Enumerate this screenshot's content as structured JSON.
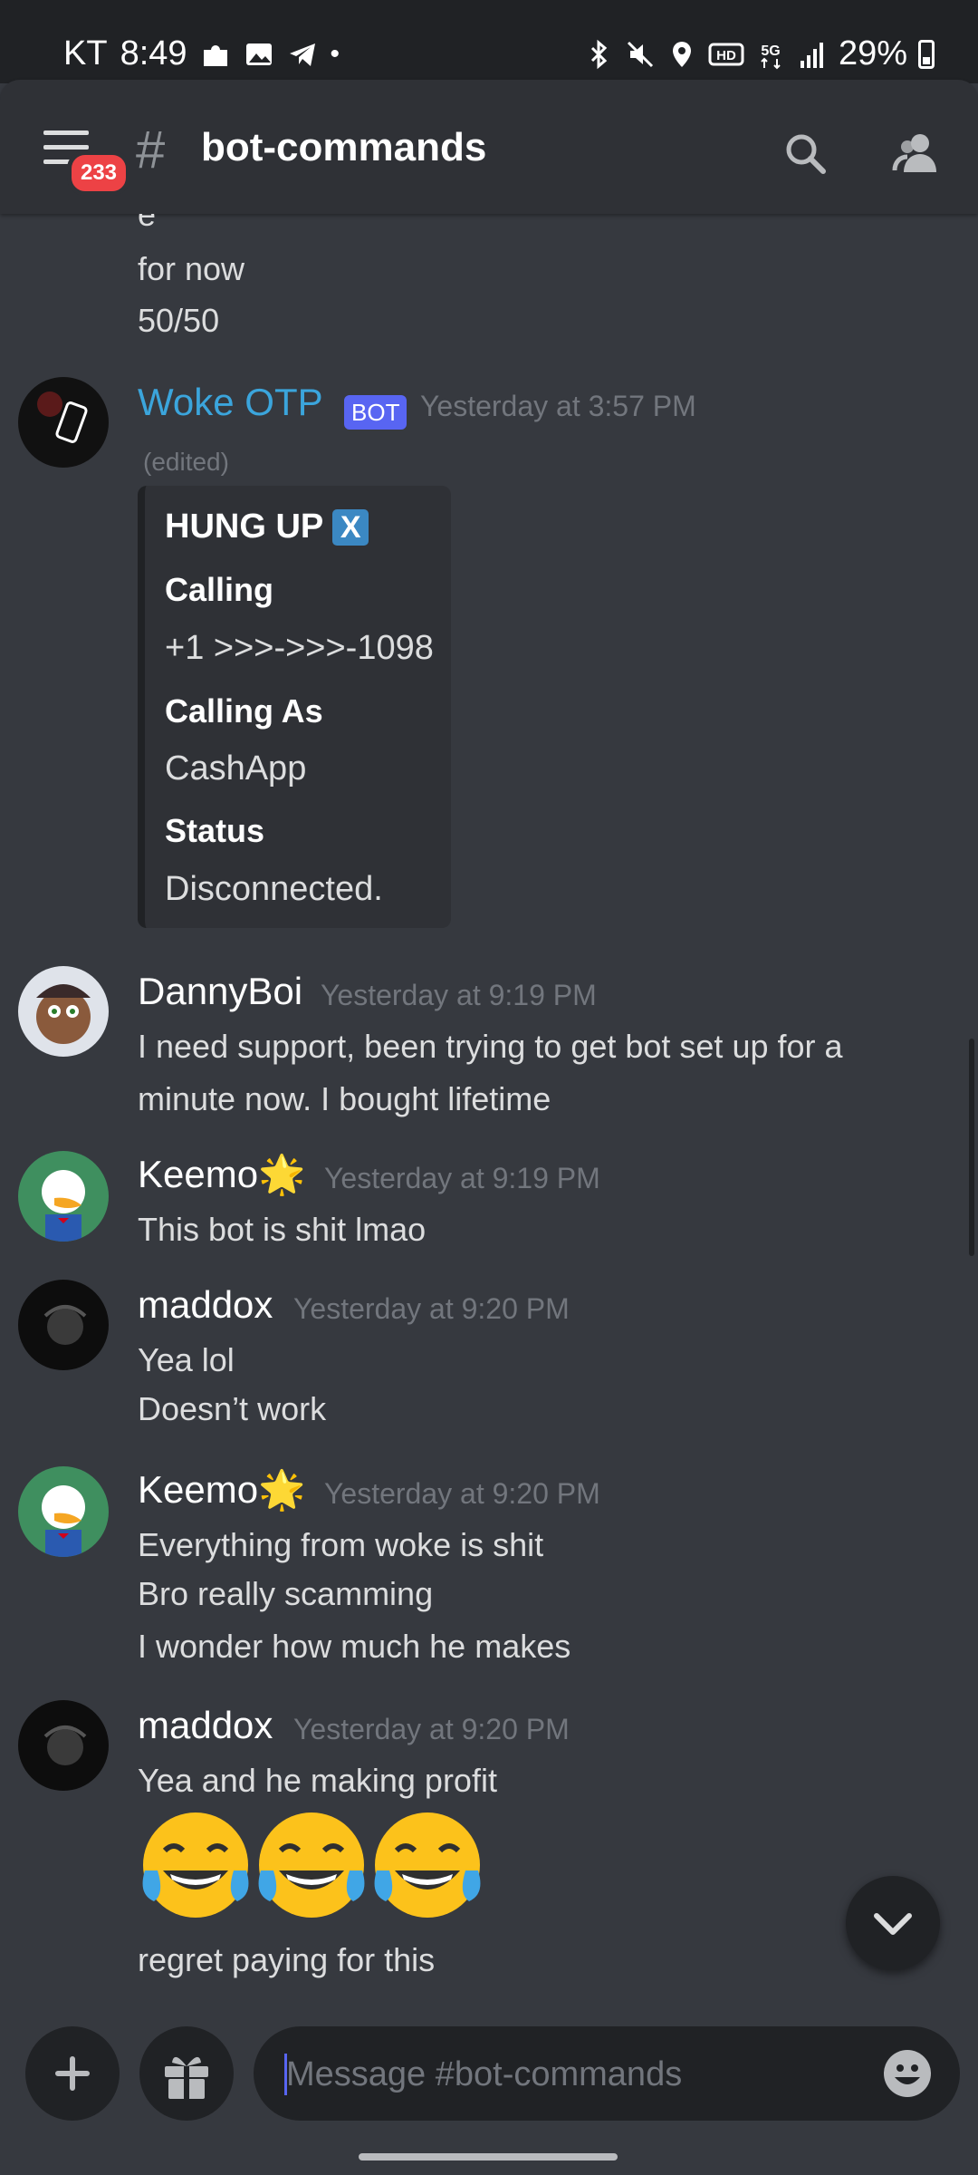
{
  "status_bar": {
    "carrier": "KT",
    "time": "8:49",
    "dot": "•",
    "battery": "29%",
    "icons_left": [
      "puzzle-icon",
      "gallery-icon",
      "telegram-icon"
    ],
    "icons_right": [
      "bluetooth-icon",
      "mute-icon",
      "location-icon",
      "hd-icon",
      "5g-icon",
      "signal-icon",
      "battery-icon"
    ]
  },
  "header": {
    "badge": "233",
    "hash": "#",
    "channel": "bot-commands"
  },
  "messages": {
    "orphan_lines": [
      "e",
      "for now",
      "50/50"
    ],
    "woke": {
      "author": "Woke OTP",
      "bot_tag": "BOT",
      "time": "Yesterday at 3:57 PM",
      "edited": "(edited)",
      "embed": {
        "title": "HUNG UP",
        "x_glyph": "X",
        "fields": [
          {
            "name": "Calling",
            "value": "+1 >>>->>>-1098"
          },
          {
            "name": "Calling As",
            "value": "CashApp"
          },
          {
            "name": "Status",
            "value": "Disconnected."
          }
        ]
      }
    },
    "danny": {
      "author": "DannyBoi",
      "time": "Yesterday at 9:19 PM",
      "lines": [
        "I need support, been trying to get bot set up for a",
        "minute now. I bought lifetime"
      ]
    },
    "keemo1": {
      "author": "Keemo🌟",
      "time": "Yesterday at 9:19 PM",
      "lines": [
        "This bot is shit lmao"
      ]
    },
    "maddox1": {
      "author": "maddox",
      "time": "Yesterday at 9:20 PM",
      "lines": [
        "Yea lol",
        "Doesn’t work"
      ]
    },
    "keemo2": {
      "author": "Keemo🌟",
      "time": "Yesterday at 9:20 PM",
      "lines": [
        "Everything from woke is shit",
        "Bro really scamming",
        "I wonder how much he makes"
      ]
    },
    "maddox2": {
      "author": "maddox",
      "time": "Yesterday at 9:20 PM",
      "lines": [
        "Yea and he making profit",
        "regret paying for this"
      ],
      "emoji": [
        "😂",
        "😂",
        "😂"
      ]
    }
  },
  "composer": {
    "placeholder": "Message #bot-commands"
  },
  "colors": {
    "background": "#36393f",
    "header": "#2f3136",
    "bot_name": "#3ba5dc",
    "bot_tag": "#5865f2",
    "badge": "#ed4245"
  }
}
